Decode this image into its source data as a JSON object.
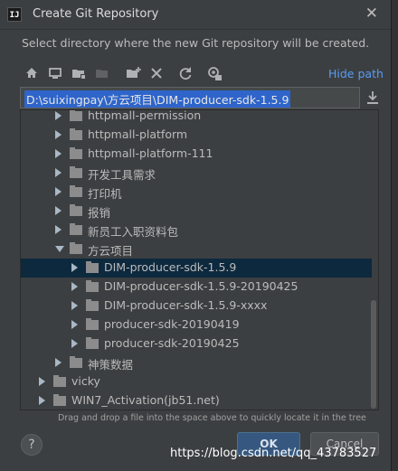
{
  "window": {
    "app_icon": "IJ",
    "title": "Create Git Repository",
    "close": "✕"
  },
  "description": "Select directory where the new Git repository will be created.",
  "toolbar": {
    "icons": [
      "home-icon",
      "desktop-icon",
      "project-folder-icon",
      "module-folder-icon",
      "new-folder-icon",
      "delete-icon",
      "refresh-icon",
      "show-hidden-icon"
    ],
    "hide_path": "Hide path"
  },
  "path_field": {
    "value": "D:\\suixingpay\\方云项目\\DIM-producer-sdk-1.5.9"
  },
  "tree": {
    "rows": [
      {
        "label": "httpmall-permission",
        "expanded": false,
        "selected": false
      },
      {
        "label": "httpmall-platform",
        "expanded": false,
        "selected": false
      },
      {
        "label": "httpmall-platform-111",
        "expanded": false,
        "selected": false
      },
      {
        "label": "开发工具需求",
        "expanded": false,
        "selected": false
      },
      {
        "label": "打印机",
        "expanded": false,
        "selected": false
      },
      {
        "label": "报销",
        "expanded": false,
        "selected": false
      },
      {
        "label": "新员工入职资料包",
        "expanded": false,
        "selected": false
      },
      {
        "label": "方云项目",
        "expanded": true,
        "selected": false
      },
      {
        "label": "DIM-producer-sdk-1.5.9",
        "expanded": false,
        "selected": true
      },
      {
        "label": "DIM-producer-sdk-1.5.9-20190425",
        "expanded": false,
        "selected": false
      },
      {
        "label": "DIM-producer-sdk-1.5.9-xxxx",
        "expanded": false,
        "selected": false
      },
      {
        "label": "producer-sdk-20190419",
        "expanded": false,
        "selected": false
      },
      {
        "label": "producer-sdk-20190425",
        "expanded": false,
        "selected": false
      },
      {
        "label": "神策数据",
        "expanded": false,
        "selected": false
      },
      {
        "label": "vicky",
        "expanded": false,
        "selected": false
      },
      {
        "label": "WIN7_Activation(jb51.net)",
        "expanded": false,
        "selected": false
      }
    ]
  },
  "hint": "Drag and drop a file into the space above to quickly locate it in the tree",
  "buttons": {
    "help": "?",
    "ok": "OK",
    "cancel": "Cancel"
  },
  "watermark": "https://blog.csdn.net/qq_43783527",
  "colors": {
    "accent": "#589df6",
    "selection": "#0d293e",
    "ok_button": "#365880"
  }
}
